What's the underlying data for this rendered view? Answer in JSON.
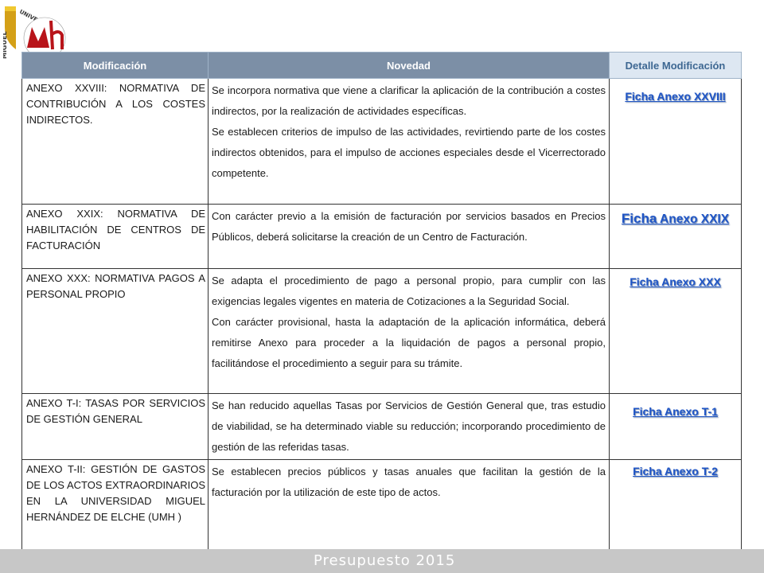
{
  "logo": {
    "text": "UNIVERSITAS-MIGUEL",
    "monogram": "mH"
  },
  "table": {
    "headers": [
      "Modificación",
      "Novedad",
      "Detalle Modificación"
    ],
    "rows": [
      {
        "modificacion": "ANEXO XXVIII: NORMATIVA DE CONTRIBUCIÓN A LOS COSTES INDIRECTOS.",
        "novedad": [
          "Se incorpora normativa que viene a clarificar la aplicación de la contribución a costes indirectos, por la realización de actividades específicas.",
          "Se establecen criterios de impulso de las actividades, revirtiendo parte de los costes indirectos obtenidos, para el impulso de acciones especiales desde el Vicerrectorado competente."
        ],
        "ficha": "Ficha Anexo XXVIII"
      },
      {
        "modificacion": "ANEXO XXIX: NORMATIVA DE HABILITACIÓN DE CENTROS DE FACTURACIÓN",
        "novedad": [
          "Con carácter previo a la emisión de facturación  por servicios basados en Precios Públicos, deberá solicitarse la creación de un Centro de Facturación."
        ],
        "ficha_lead": "Ficha",
        "ficha_rest": " Anexo XXIX"
      },
      {
        "modificacion": "ANEXO XXX: NORMATIVA PAGOS A PERSONAL PROPIO",
        "novedad": [
          "Se adapta el procedimiento de pago a personal propio, para cumplir con las exigencias legales vigentes en materia de Cotizaciones a la Seguridad Social.",
          "Con carácter provisional, hasta la adaptación de la aplicación informática, deberá remitirse Anexo para proceder a la liquidación de pagos a personal propio, facilitándose el procedimiento a seguir para su trámite."
        ],
        "ficha": "Ficha Anexo XXX"
      },
      {
        "modificacion": "ANEXO T-I: TASAS POR SERVICIOS DE GESTIÓN GENERAL",
        "novedad": [
          "Se han reducido aquellas Tasas por Servicios de Gestión General que, tras estudio de viabilidad, se ha determinado viable su reducción; incorporando procedimiento de gestión de las referidas tasas."
        ],
        "ficha": "Ficha Anexo T-1"
      },
      {
        "modificacion": "ANEXO T-II: GESTIÓN DE GASTOS DE LOS ACTOS EXTRAORDINARIOS EN LA UNIVERSIDAD MIGUEL HERNÁNDEZ DE ELCHE (UMH )",
        "novedad": [
          "Se establecen precios públicos y tasas anuales que facilitan la gestión de la facturación por la utilización de este tipo de actos."
        ],
        "ficha": "Ficha Anexo T-2"
      }
    ]
  },
  "footer": {
    "title": "Presupuesto 2015"
  },
  "colors": {
    "header_dark": "#7c8fa6",
    "header_light": "#dde7f2",
    "link": "#1f55c6",
    "footer": "#c7c7c7"
  }
}
